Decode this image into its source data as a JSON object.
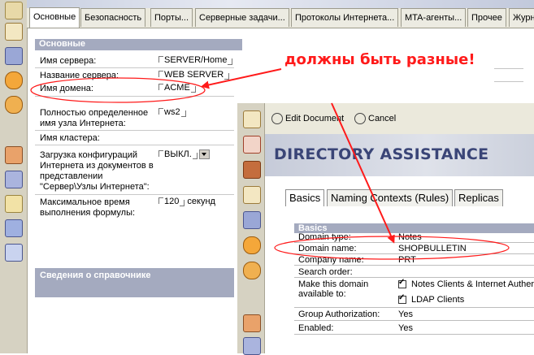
{
  "back_window": {
    "tabs": [
      "Основные",
      "Безопасность",
      "Порты...",
      "Серверные задачи...",
      "Протоколы Интернета...",
      "MTA-агенты...",
      "Прочее",
      "Журн"
    ],
    "section_main": "Основные",
    "fields": {
      "server_name_label": "Имя сервера:",
      "server_name_value": "SERVER/Home",
      "server_title_label": "Название сервера:",
      "server_title_value": "WEB SERVER",
      "domain_label": "Имя домена:",
      "domain_value": "ACME",
      "fqdn_label": "Полностью определенное имя узла Интернета:",
      "fqdn_value": "ws2",
      "cluster_label": "Имя кластера:",
      "config_label": "Загрузка конфигураций Интернета из документов в представлении \"Сервер\\Узлы Интернета\":",
      "config_value": "ВЫКЛ.",
      "formula_label": "Максимальное время выполнения формулы:",
      "formula_value": "120",
      "formula_unit": "секунд"
    },
    "section_directory": "Сведения о справочнике"
  },
  "annotation": {
    "text": "должны быть разные!",
    "color": "#ff1a1a"
  },
  "front_window": {
    "toolbar": {
      "edit_label": "Edit Document",
      "cancel_label": "Cancel"
    },
    "header_title": "DIRECTORY ASSISTANCE",
    "tabs": [
      "Basics",
      "Naming Contexts (Rules)",
      "Replicas"
    ],
    "section": "Basics",
    "fields": {
      "domain_type_label": "Domain type:",
      "domain_type_value": "Notes",
      "domain_name_label": "Domain name:",
      "domain_name_value": "SHOPBULLETIN",
      "company_label": "Company name:",
      "company_value": "PRT",
      "search_order_label": "Search order:",
      "available_label": "Make this domain available to:",
      "available_opt1": "Notes Clients & Internet Auther",
      "available_opt2": "LDAP Clients",
      "group_auth_label": "Group Authorization:",
      "group_auth_value": "Yes",
      "enabled_label": "Enabled:",
      "enabled_value": "Yes"
    }
  }
}
